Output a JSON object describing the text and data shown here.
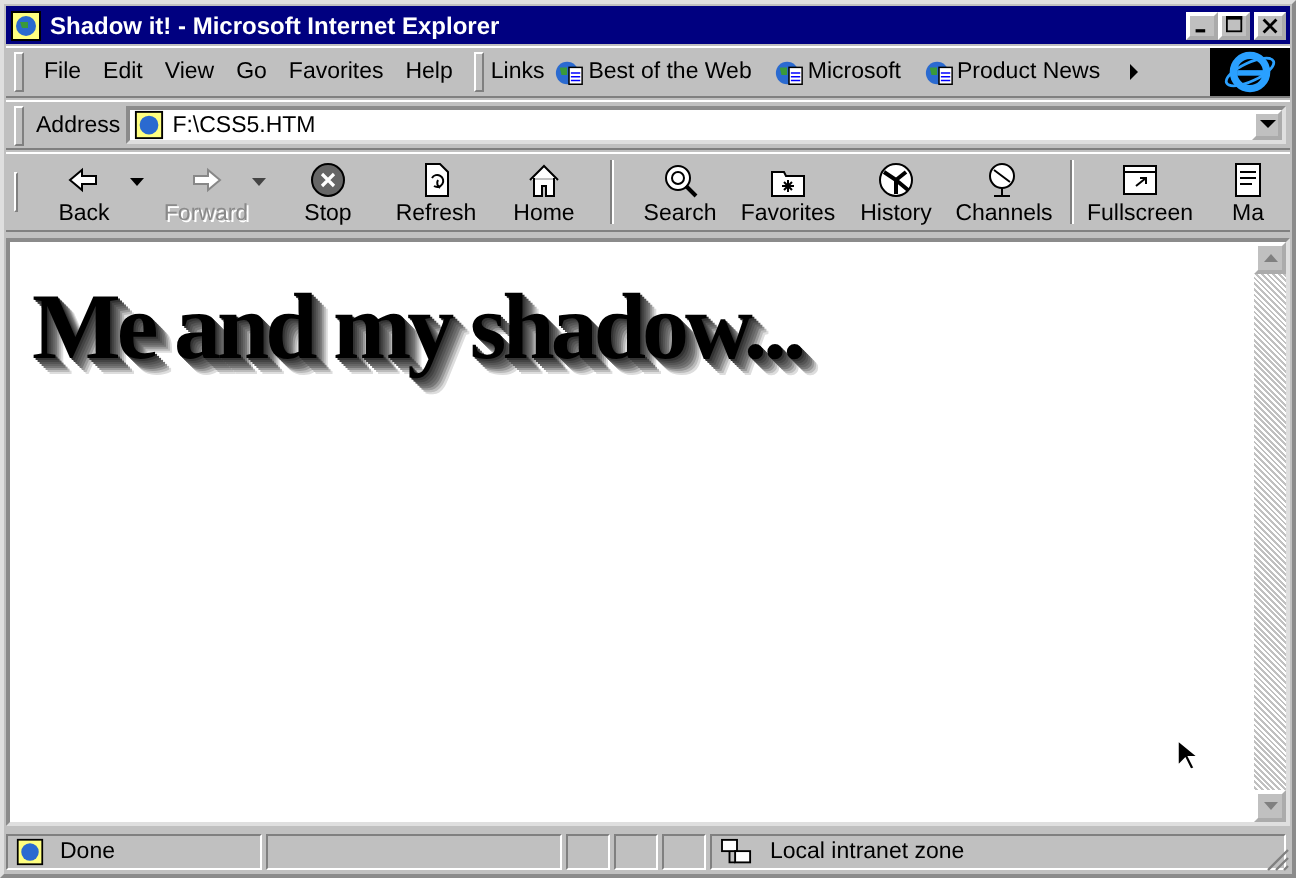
{
  "window": {
    "title": "Shadow it! - Microsoft Internet Explorer"
  },
  "menu": [
    "File",
    "Edit",
    "View",
    "Go",
    "Favorites",
    "Help"
  ],
  "links": {
    "label": "Links",
    "items": [
      "Best of the Web",
      "Microsoft",
      "Product News"
    ]
  },
  "address": {
    "label": "Address",
    "value": "F:\\CSS5.HTM"
  },
  "toolbar": [
    [
      {
        "label": "Back",
        "disabled": false,
        "dropdown": true
      },
      {
        "label": "Forward",
        "disabled": true,
        "dropdown": true
      },
      {
        "label": "Stop",
        "disabled": false,
        "dropdown": false
      },
      {
        "label": "Refresh",
        "disabled": false,
        "dropdown": false
      },
      {
        "label": "Home",
        "disabled": false,
        "dropdown": false
      }
    ],
    [
      {
        "label": "Search",
        "disabled": false,
        "dropdown": false
      },
      {
        "label": "Favorites",
        "disabled": false,
        "dropdown": false
      },
      {
        "label": "History",
        "disabled": false,
        "dropdown": false
      },
      {
        "label": "Channels",
        "disabled": false,
        "dropdown": false
      }
    ],
    [
      {
        "label": "Fullscreen",
        "disabled": false,
        "dropdown": false
      },
      {
        "label": "Ma",
        "disabled": false,
        "dropdown": false
      }
    ]
  ],
  "page": {
    "heading": "Me and my shadow..."
  },
  "status_bar": {
    "status": "Done",
    "zone": "Local intranet zone"
  }
}
